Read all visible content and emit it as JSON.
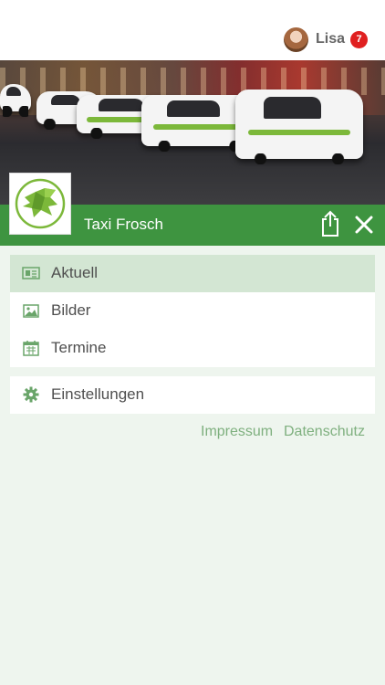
{
  "user": {
    "name": "Lisa",
    "notification_count": "7"
  },
  "hero": {
    "description": "taxi-rank-photo"
  },
  "app": {
    "title": "Taxi Frosch"
  },
  "colors": {
    "brand_green": "#3e9440",
    "active_bg": "#d3e6d3",
    "badge_red": "#e02020",
    "link_green": "#7fb07f"
  },
  "menu": {
    "primary": [
      {
        "label": "Aktuell",
        "icon": "newspaper-icon",
        "active": true
      },
      {
        "label": "Bilder",
        "icon": "image-icon",
        "active": false
      },
      {
        "label": "Termine",
        "icon": "calendar-icon",
        "active": false
      }
    ],
    "secondary": [
      {
        "label": "Einstellungen",
        "icon": "gear-icon",
        "active": false
      }
    ]
  },
  "footer": {
    "impressum": "Impressum",
    "datenschutz": "Datenschutz"
  }
}
